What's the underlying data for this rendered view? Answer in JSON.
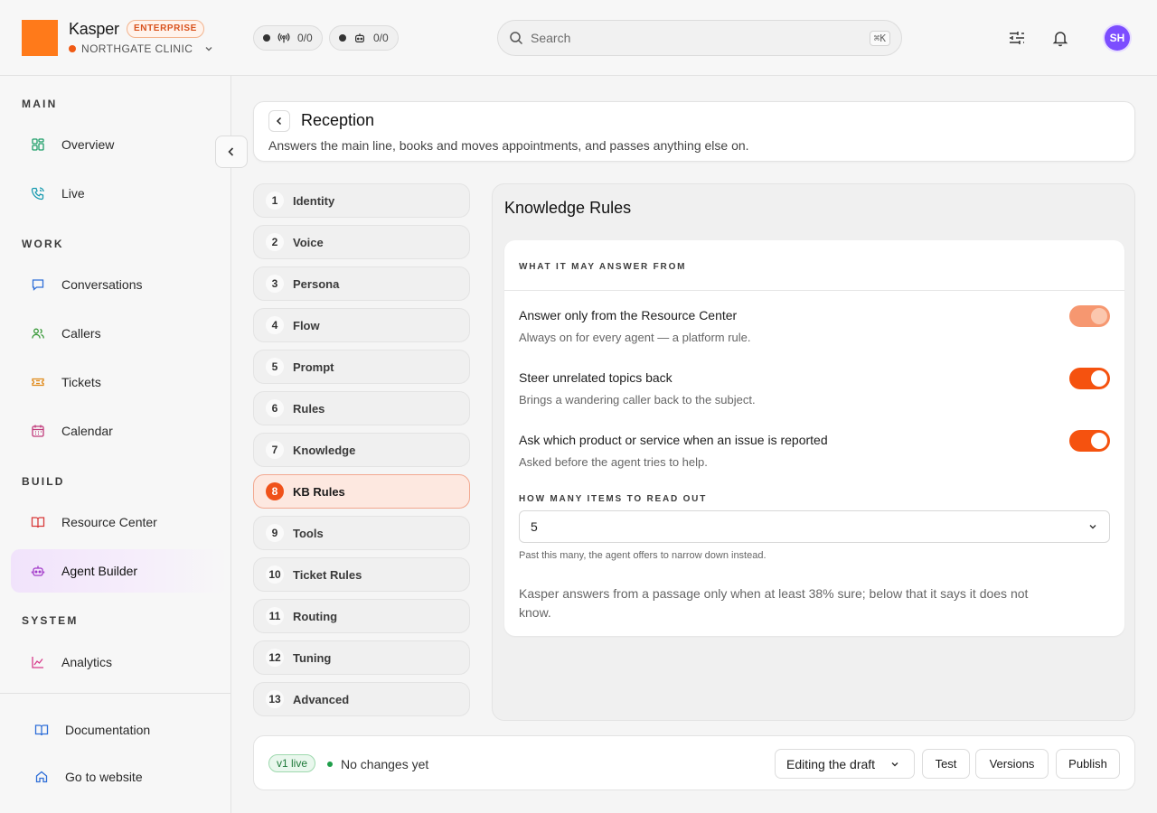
{
  "brand": {
    "name": "Kasper",
    "badge": "ENTERPRISE",
    "org": "NORTHGATE CLINIC",
    "colors": {
      "accent": "#f5520f",
      "logo": "#ff7a1a",
      "avatar": "#7c4dff"
    }
  },
  "topbar": {
    "calls_counter": {
      "icon": "broadcast-icon",
      "value": "0/0"
    },
    "agents_counter": {
      "icon": "robot-icon",
      "value": "0/0"
    },
    "search": {
      "placeholder": "Search",
      "shortcut": "⌘K"
    },
    "avatar_initials": "SH"
  },
  "sidebar": {
    "sections": {
      "main": "MAIN",
      "work": "WORK",
      "build": "BUILD",
      "system": "SYSTEM"
    },
    "items": {
      "overview": "Overview",
      "live": "Live",
      "conversations": "Conversations",
      "callers": "Callers",
      "tickets": "Tickets",
      "calendar": "Calendar",
      "resource_center": "Resource Center",
      "agent_builder": "Agent Builder",
      "analytics": "Analytics"
    },
    "footer": {
      "documentation": "Documentation",
      "website": "Go to website"
    },
    "active": "agent_builder"
  },
  "agent": {
    "name": "Reception",
    "description": "Answers the main line, books and moves appointments, and passes anything else on."
  },
  "steps": [
    {
      "num": "1",
      "label": "Identity"
    },
    {
      "num": "2",
      "label": "Voice"
    },
    {
      "num": "3",
      "label": "Persona"
    },
    {
      "num": "4",
      "label": "Flow"
    },
    {
      "num": "5",
      "label": "Prompt"
    },
    {
      "num": "6",
      "label": "Rules"
    },
    {
      "num": "7",
      "label": "Knowledge"
    },
    {
      "num": "8",
      "label": "KB Rules"
    },
    {
      "num": "9",
      "label": "Tools"
    },
    {
      "num": "10",
      "label": "Ticket Rules"
    },
    {
      "num": "11",
      "label": "Routing"
    },
    {
      "num": "12",
      "label": "Tuning"
    },
    {
      "num": "13",
      "label": "Advanced"
    }
  ],
  "active_step": "8",
  "panel": {
    "title": "Knowledge Rules",
    "section_heading": "WHAT IT MAY ANSWER FROM",
    "rules": [
      {
        "title": "Answer only from the Resource Center",
        "desc": "Always on for every agent — a platform rule.",
        "enabled": true,
        "locked": true
      },
      {
        "title": "Steer unrelated topics back",
        "desc": "Brings a wandering caller back to the subject.",
        "enabled": true,
        "locked": false
      },
      {
        "title": "Ask which product or service when an issue is reported",
        "desc": "Asked before the agent tries to help.",
        "enabled": true,
        "locked": false
      }
    ],
    "items_label": "HOW MANY ITEMS TO READ OUT",
    "items_value": "5",
    "items_hint": "Past this many, the agent offers to narrow down instead.",
    "confidence_note": "Kasper answers from a passage only when at least 38% sure; below that it says it does not know."
  },
  "footer": {
    "version_badge": "v1 live",
    "status": "No changes yet",
    "mode": "Editing the draft",
    "test": "Test",
    "versions": "Versions",
    "publish": "Publish"
  }
}
